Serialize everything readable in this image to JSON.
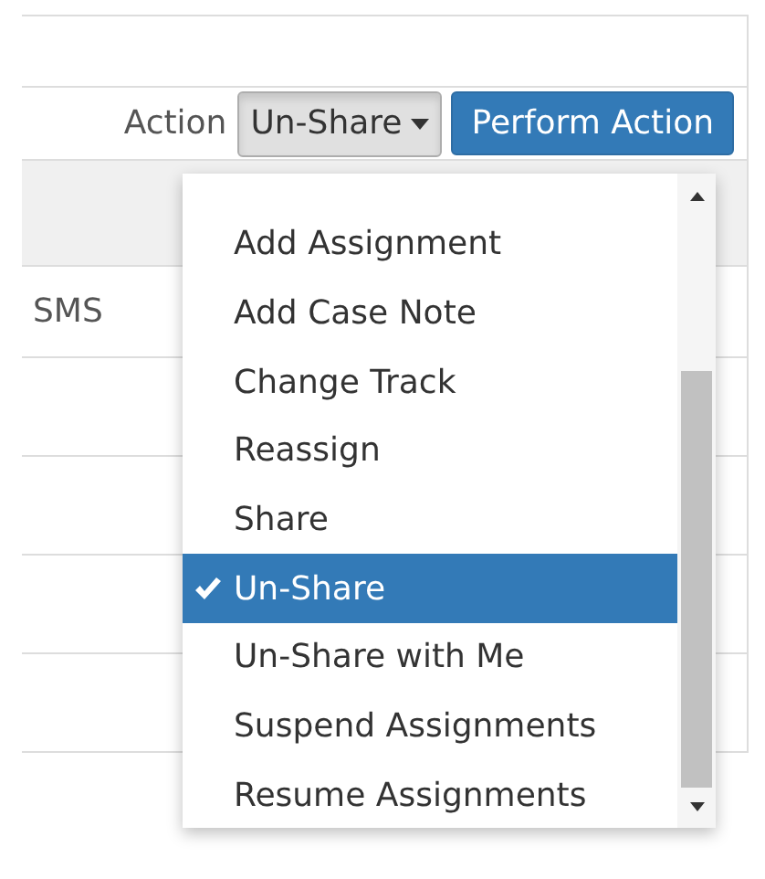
{
  "toolbar": {
    "label": "Action",
    "select": {
      "value": "Un-Share",
      "expanded": true
    },
    "button": "Perform Action"
  },
  "table": {
    "rows": [
      {
        "cell": "SMS"
      },
      {},
      {},
      {},
      {}
    ]
  },
  "dropdown": {
    "options": [
      {
        "label": "Add Assignment",
        "selected": false
      },
      {
        "label": "Add Case Note",
        "selected": false
      },
      {
        "label": "Change Track",
        "selected": false
      },
      {
        "label": "Reassign",
        "selected": false
      },
      {
        "label": "Share",
        "selected": false
      },
      {
        "label": "Un-Share",
        "selected": true
      },
      {
        "label": "Un-Share with Me",
        "selected": false
      },
      {
        "label": "Suspend Assignments",
        "selected": false
      },
      {
        "label": "Resume Assignments",
        "selected": false
      }
    ]
  }
}
